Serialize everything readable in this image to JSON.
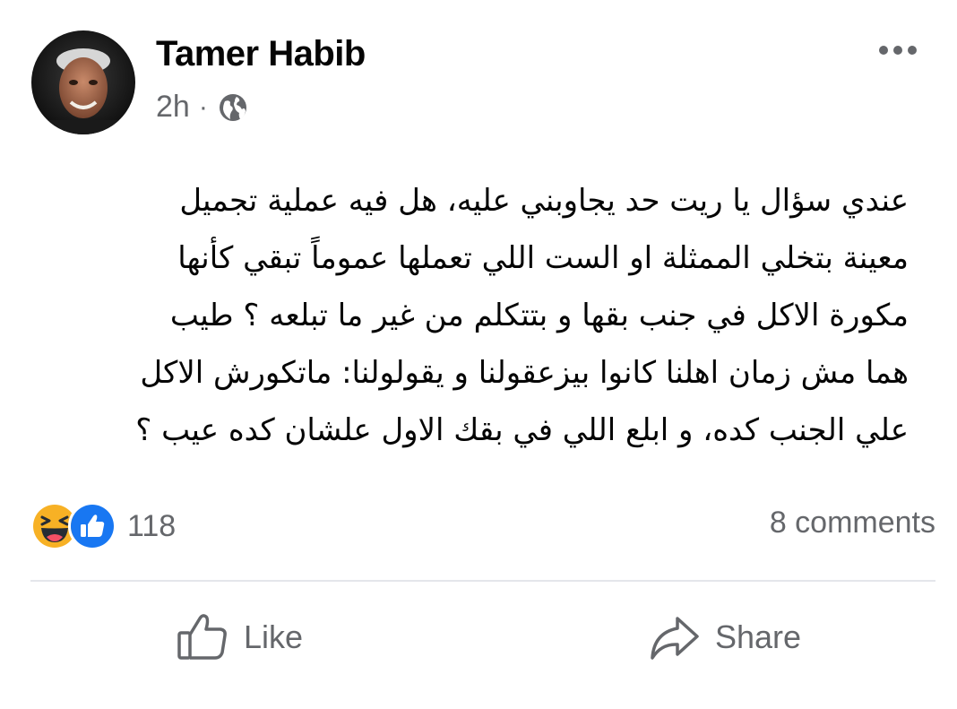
{
  "post": {
    "author": "Tamer Habib",
    "time": "2h",
    "separator": "·",
    "audience_icon": "globe-icon",
    "more_icon": "more-options-icon",
    "text": "عندي سؤال يا ريت حد يجاوبني عليه، هل فيه عملية تجميل\nمعينة بتخلي الممثلة او الست اللي تعملها عموماً تبقي كأنها\nمكورة الاكل في جنب بقها و بتتكلم من غير ما تبلعه ؟ طيب\nهما مش زمان اهلنا كانوا بيزعقولنا و يقولولنا: ماتكورش الاكل\nعلي الجنب كده، و ابلع اللي في بقك الاول علشان كده عيب ؟"
  },
  "engagement": {
    "reaction_icons": [
      "haha-icon",
      "like-reaction-icon"
    ],
    "reaction_count": "118",
    "comments": "8 comments"
  },
  "actions": {
    "like_label": "Like",
    "share_label": "Share"
  },
  "colors": {
    "text": "#050505",
    "secondary": "#65676b",
    "divider": "#e4e6eb",
    "like_blue": "#1877f2",
    "haha_yellow": "#f7b125"
  }
}
